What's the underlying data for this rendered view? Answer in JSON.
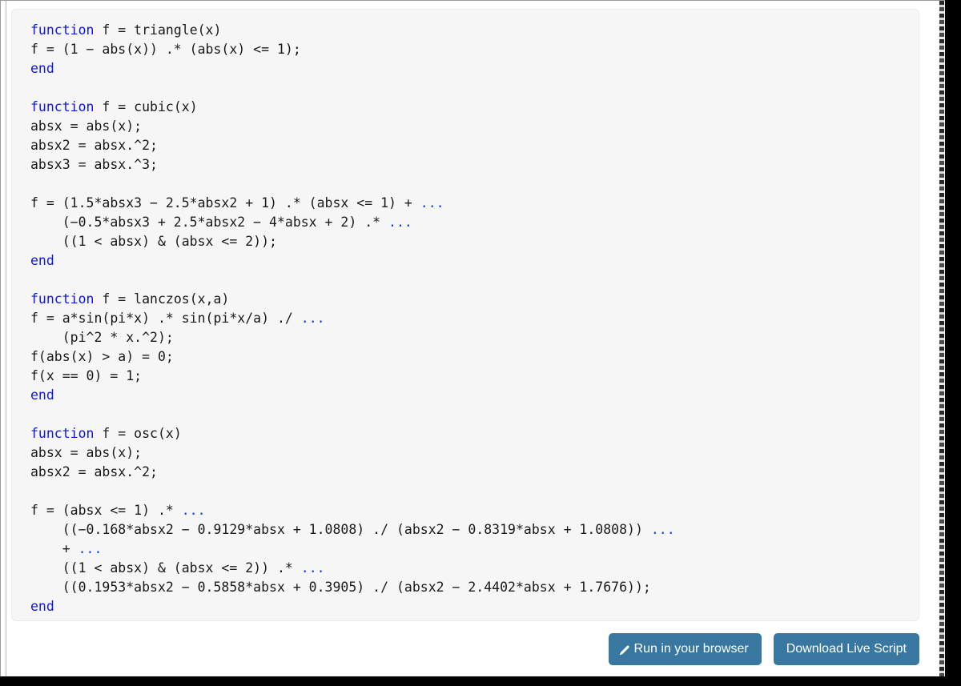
{
  "page": {
    "background_color": "#ffffff",
    "outer_color": "#000000"
  },
  "code_block": {
    "language": "matlab",
    "background_color": "#f6f6f6",
    "keyword_color": "#1015e8",
    "continuation_color": "#1a3ae8",
    "text_color": "#1a1a1a",
    "source": "function f = triangle(x)\nf = (1 − abs(x)) .* (abs(x) <= 1);\nend\n\nfunction f = cubic(x)\nabsx = abs(x);\nabsx2 = absx.^2;\nabsx3 = absx.^3;\n\nf = (1.5*absx3 − 2.5*absx2 + 1) .* (absx <= 1) + ...\n    (−0.5*absx3 + 2.5*absx2 − 4*absx + 2) .* ...\n    ((1 < absx) & (absx <= 2));\nend\n\nfunction f = lanczos(x,a)\nf = a*sin(pi*x) .* sin(pi*x/a) ./ ...\n    (pi^2 * x.^2);\nf(abs(x) > a) = 0;\nf(x == 0) = 1;\nend\n\nfunction f = osc(x)\nabsx = abs(x);\nabsx2 = absx.^2;\n\nf = (absx <= 1) .* ...\n    ((−0.168*absx2 − 0.9129*absx + 1.0808) ./ (absx2 − 0.8319*absx + 1.0808)) ...\n    + ...\n    ((1 < absx) & (absx <= 2)) .* ...\n    ((0.1953*absx2 − 0.5858*absx + 0.3905) ./ (absx2 − 2.4402*absx + 1.7676));\nend",
    "lines": [
      {
        "segments": [
          {
            "t": "function",
            "c": "kw"
          },
          {
            "t": " f = triangle(x)",
            "c": ""
          }
        ]
      },
      {
        "segments": [
          {
            "t": "f = (1 − abs(x)) .* (abs(x) <= 1);",
            "c": ""
          }
        ]
      },
      {
        "segments": [
          {
            "t": "end",
            "c": "kw"
          }
        ]
      },
      {
        "segments": [
          {
            "t": "",
            "c": ""
          }
        ]
      },
      {
        "segments": [
          {
            "t": "function",
            "c": "kw"
          },
          {
            "t": " f = cubic(x)",
            "c": ""
          }
        ]
      },
      {
        "segments": [
          {
            "t": "absx = abs(x);",
            "c": ""
          }
        ]
      },
      {
        "segments": [
          {
            "t": "absx2 = absx.^2;",
            "c": ""
          }
        ]
      },
      {
        "segments": [
          {
            "t": "absx3 = absx.^3;",
            "c": ""
          }
        ]
      },
      {
        "segments": [
          {
            "t": "",
            "c": ""
          }
        ]
      },
      {
        "segments": [
          {
            "t": "f = (1.5*absx3 − 2.5*absx2 + 1) .* (absx <= 1) + ",
            "c": ""
          },
          {
            "t": "...",
            "c": "cont"
          }
        ]
      },
      {
        "segments": [
          {
            "t": "    (−0.5*absx3 + 2.5*absx2 − 4*absx + 2) .* ",
            "c": ""
          },
          {
            "t": "...",
            "c": "cont"
          }
        ]
      },
      {
        "segments": [
          {
            "t": "    ((1 < absx) & (absx <= 2));",
            "c": ""
          }
        ]
      },
      {
        "segments": [
          {
            "t": "end",
            "c": "kw"
          }
        ]
      },
      {
        "segments": [
          {
            "t": "",
            "c": ""
          }
        ]
      },
      {
        "segments": [
          {
            "t": "function",
            "c": "kw"
          },
          {
            "t": " f = lanczos(x,a)",
            "c": ""
          }
        ]
      },
      {
        "segments": [
          {
            "t": "f = a*sin(pi*x) .* sin(pi*x/a) ./ ",
            "c": ""
          },
          {
            "t": "...",
            "c": "cont"
          }
        ]
      },
      {
        "segments": [
          {
            "t": "    (pi^2 * x.^2);",
            "c": ""
          }
        ]
      },
      {
        "segments": [
          {
            "t": "f(abs(x) > a) = 0;",
            "c": ""
          }
        ]
      },
      {
        "segments": [
          {
            "t": "f(x == 0) = 1;",
            "c": ""
          }
        ]
      },
      {
        "segments": [
          {
            "t": "end",
            "c": "kw"
          }
        ]
      },
      {
        "segments": [
          {
            "t": "",
            "c": ""
          }
        ]
      },
      {
        "segments": [
          {
            "t": "function",
            "c": "kw"
          },
          {
            "t": " f = osc(x)",
            "c": ""
          }
        ]
      },
      {
        "segments": [
          {
            "t": "absx = abs(x);",
            "c": ""
          }
        ]
      },
      {
        "segments": [
          {
            "t": "absx2 = absx.^2;",
            "c": ""
          }
        ]
      },
      {
        "segments": [
          {
            "t": "",
            "c": ""
          }
        ]
      },
      {
        "segments": [
          {
            "t": "f = (absx <= 1) .* ",
            "c": ""
          },
          {
            "t": "...",
            "c": "cont"
          }
        ]
      },
      {
        "segments": [
          {
            "t": "    ((−0.168*absx2 − 0.9129*absx + 1.0808) ./ (absx2 − 0.8319*absx + 1.0808)) ",
            "c": ""
          },
          {
            "t": "...",
            "c": "cont"
          }
        ]
      },
      {
        "segments": [
          {
            "t": "    + ",
            "c": ""
          },
          {
            "t": "...",
            "c": "cont"
          }
        ]
      },
      {
        "segments": [
          {
            "t": "    ((1 < absx) & (absx <= 2)) .* ",
            "c": ""
          },
          {
            "t": "...",
            "c": "cont"
          }
        ]
      },
      {
        "segments": [
          {
            "t": "    ((0.1953*absx2 − 0.5858*absx + 0.3905) ./ (absx2 − 2.4402*absx + 1.7676));",
            "c": ""
          }
        ]
      },
      {
        "segments": [
          {
            "t": "end",
            "c": "kw"
          }
        ]
      }
    ]
  },
  "actions": {
    "accent_color": "#3878a0",
    "run_label": "Run in your browser",
    "run_icon": "pencil-icon",
    "download_label": "Download Live Script"
  }
}
